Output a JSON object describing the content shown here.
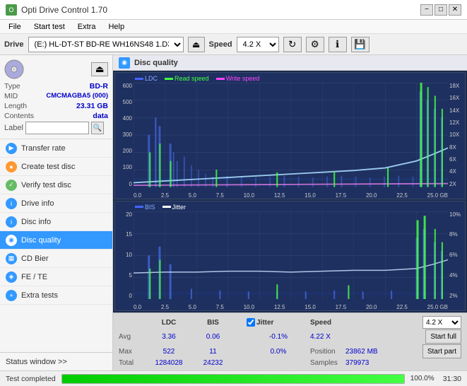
{
  "titleBar": {
    "title": "Opti Drive Control 1.70",
    "icon": "O",
    "controls": {
      "minimize": "−",
      "maximize": "□",
      "close": "✕"
    }
  },
  "menuBar": {
    "items": [
      "File",
      "Start test",
      "Extra",
      "Help"
    ]
  },
  "driveToolbar": {
    "label": "Drive",
    "driveValue": "(E:)  HL-DT-ST BD-RE  WH16NS48 1.D3",
    "speedLabel": "Speed",
    "speedValue": "4.2 X"
  },
  "sidebar": {
    "discSection": {
      "type": {
        "key": "Type",
        "value": "BD-R"
      },
      "mid": {
        "key": "MID",
        "value": "CMCMAGBA5 (000)"
      },
      "length": {
        "key": "Length",
        "value": "23.31 GB"
      },
      "contents": {
        "key": "Contents",
        "value": "data"
      },
      "label": {
        "key": "Label",
        "placeholder": ""
      }
    },
    "navItems": [
      {
        "id": "transfer-rate",
        "label": "Transfer rate",
        "icon": "▶",
        "iconClass": "blue"
      },
      {
        "id": "create-test-disc",
        "label": "Create test disc",
        "icon": "●",
        "iconClass": "orange"
      },
      {
        "id": "verify-test-disc",
        "label": "Verify test disc",
        "icon": "✓",
        "iconClass": "green"
      },
      {
        "id": "drive-info",
        "label": "Drive info",
        "icon": "i",
        "iconClass": "blue"
      },
      {
        "id": "disc-info",
        "label": "Disc info",
        "icon": "i",
        "iconClass": "blue"
      },
      {
        "id": "disc-quality",
        "label": "Disc quality",
        "icon": "◉",
        "iconClass": "blue",
        "active": true
      },
      {
        "id": "cd-bier",
        "label": "CD Bier",
        "icon": "▦",
        "iconClass": "blue"
      },
      {
        "id": "fe-te",
        "label": "FE / TE",
        "icon": "◈",
        "iconClass": "blue"
      },
      {
        "id": "extra-tests",
        "label": "Extra tests",
        "icon": "+",
        "iconClass": "blue"
      }
    ],
    "statusWindow": "Status window >>"
  },
  "chart": {
    "title": "Disc quality",
    "legend1": {
      "ldc": "LDC",
      "readSpeed": "Read speed",
      "writeSpeed": "Write speed"
    },
    "legend2": {
      "bis": "BIS",
      "jitter": "Jitter"
    },
    "xAxisMax": "25.0",
    "xAxisLabel": "GB",
    "chart1YMax": "600",
    "chart1YRight": "18X",
    "chart2YMax": "20",
    "chart2YRight": "10%"
  },
  "statsBar": {
    "headers": [
      "LDC",
      "BIS",
      "",
      "Jitter",
      "Speed",
      ""
    ],
    "avgRow": {
      "label": "Avg",
      "ldc": "3.36",
      "bis": "0.06",
      "jitter": "-0.1%",
      "speed": "4.22 X"
    },
    "maxRow": {
      "label": "Max",
      "ldc": "522",
      "bis": "11",
      "jitter": "0.0%",
      "position": "23862 MB"
    },
    "totalRow": {
      "label": "Total",
      "ldc": "1284028",
      "bis": "24232",
      "samples": "379973"
    },
    "positionLabel": "Position",
    "samplesLabel": "Samples",
    "speedSelectValue": "4.2 X",
    "startFullLabel": "Start full",
    "startPartLabel": "Start part"
  },
  "statusBar": {
    "text": "Test completed",
    "progressPercent": 100,
    "progressText": "100.0%",
    "time": "31:30"
  }
}
